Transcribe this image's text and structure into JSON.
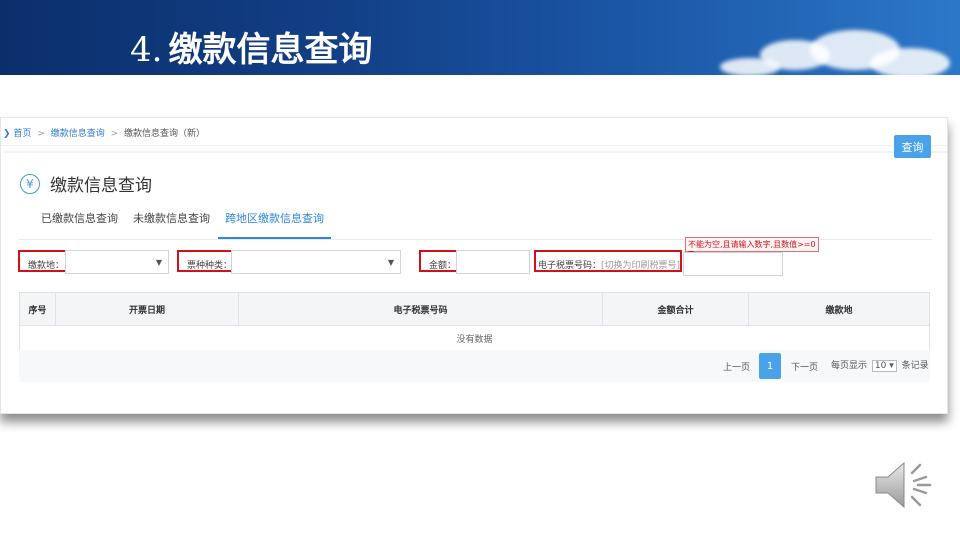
{
  "slide": {
    "number": "4.",
    "title": "缴款信息查询"
  },
  "breadcrumb": {
    "home": "首页",
    "sep": ">",
    "parent": "缴款信息查询",
    "current": "缴款信息查询（新）"
  },
  "page": {
    "title": "缴款信息查询",
    "icon": "yen-circle-icon"
  },
  "tabs": [
    {
      "label": "已缴款信息查询",
      "active": false
    },
    {
      "label": "未缴款信息查询",
      "active": false
    },
    {
      "label": "跨地区缴款信息查询",
      "active": true
    }
  ],
  "filters": {
    "payment_place_label": "缴款地：",
    "tax_type_label": "票种种类：",
    "amount_label": "金额：",
    "eticket_label": "电子税票号码：",
    "eticket_hint": "[切换为印刷税票号]",
    "error_tip": "不能为空,且请输入数字,且数值>=0",
    "query_button": "查询"
  },
  "table": {
    "columns": [
      "序号",
      "开票日期",
      "电子税票号码",
      "金额合计",
      "缴款地"
    ],
    "empty_text": "没有数据"
  },
  "pagination": {
    "prev": "上一页",
    "current_page": "1",
    "next": "下一页",
    "per_page_prefix": "每页显示",
    "per_page_value": "10",
    "per_page_suffix": "条记录"
  },
  "colors": {
    "banner": "#123f86",
    "accent": "#4aa3ea",
    "highlight_box": "#d0111b"
  }
}
